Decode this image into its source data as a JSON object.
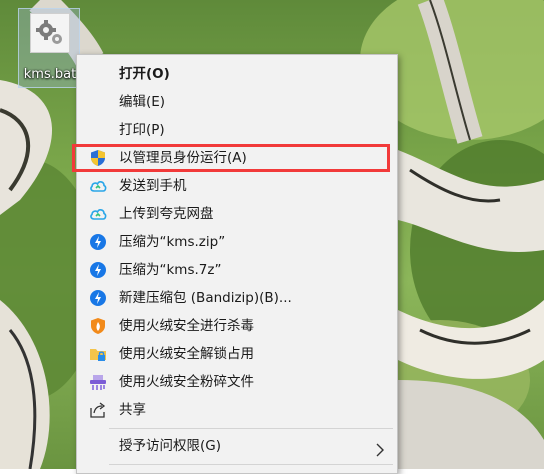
{
  "desktop": {
    "file_label": "kms.bat",
    "icon": "gear-file-icon"
  },
  "menu": {
    "items": [
      {
        "label": "打开(O)",
        "icon": "none"
      },
      {
        "label": "编辑(E)",
        "icon": "none"
      },
      {
        "label": "打印(P)",
        "icon": "none"
      },
      {
        "label": "以管理员身份运行(A)",
        "icon": "uac-shield-icon"
      },
      {
        "label": "发送到手机",
        "icon": "cloud-icon"
      },
      {
        "label": "上传到夸克网盘",
        "icon": "cloud-icon"
      },
      {
        "label": "压缩为“kms.zip”",
        "icon": "bandizip-icon"
      },
      {
        "label": "压缩为“kms.7z”",
        "icon": "bandizip-icon"
      },
      {
        "label": "新建压缩包 (Bandizip)(B)...",
        "icon": "bandizip-icon"
      },
      {
        "label": "使用火绒安全进行杀毒",
        "icon": "huorong-shield-icon"
      },
      {
        "label": "使用火绒安全解锁占用",
        "icon": "folder-lock-icon"
      },
      {
        "label": "使用火绒安全粉碎文件",
        "icon": "shredder-icon"
      },
      {
        "label": "共享",
        "icon": "share-icon"
      },
      {
        "label": "授予访问权限(G)",
        "icon": "none"
      }
    ]
  },
  "colors": {
    "highlight": "#f23a3a",
    "menu_bg": "#f2f2f2",
    "bandizip": "#1877e6",
    "huorong": "#f28a1a"
  }
}
